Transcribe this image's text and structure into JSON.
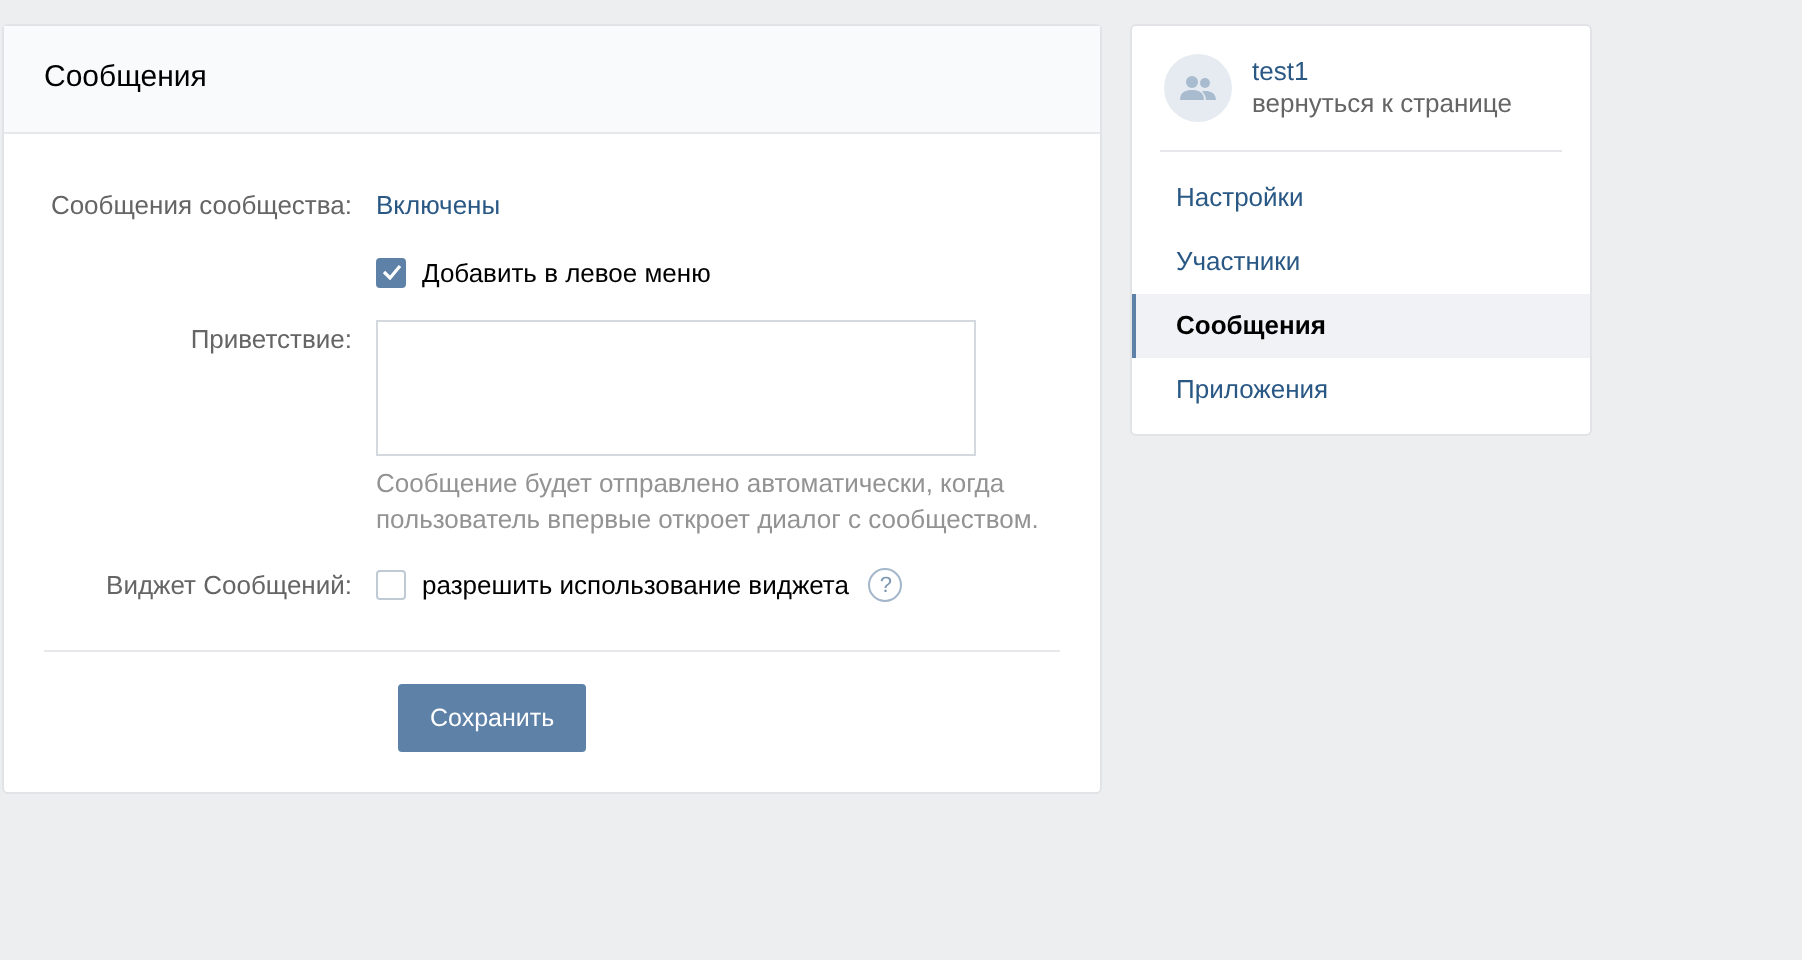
{
  "page": {
    "title": "Сообщения"
  },
  "settings": [
    {
      "kind": "link",
      "label": "Сообщения сообщества:",
      "value": "Включены"
    },
    {
      "kind": "checkbox",
      "text": "Добавить в левое меню",
      "checked": true
    },
    {
      "kind": "textarea",
      "label": "Приветствие:",
      "hint": "Сообщение будет отправлено автоматически, когда пользователь впервые откроет диалог с сообществом."
    },
    {
      "kind": "checkbox",
      "label": "Виджет Сообщений:",
      "text": "разрешить использование виджета",
      "checked": false,
      "help": "?"
    }
  ],
  "save_button": "Сохранить",
  "sidebar": {
    "name": "test1",
    "back_link": "вернуться к странице",
    "items": [
      {
        "label": "Настройки",
        "selected": false
      },
      {
        "label": "Участники",
        "selected": false
      },
      {
        "label": "Сообщения",
        "selected": true
      },
      {
        "label": "Приложения",
        "selected": false
      }
    ]
  }
}
